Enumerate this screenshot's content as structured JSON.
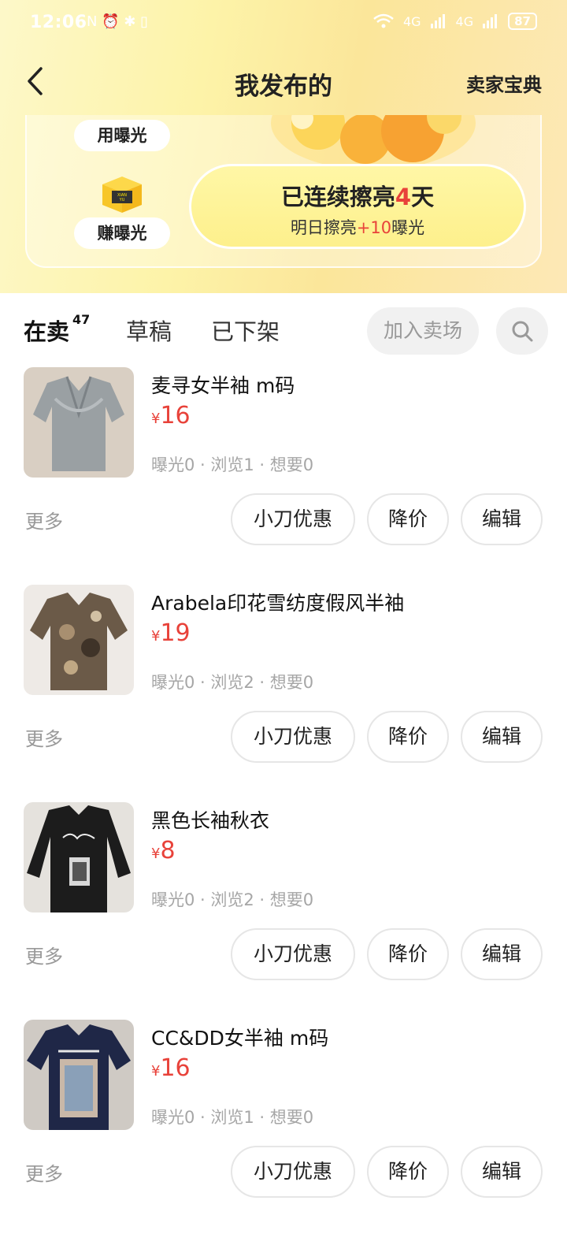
{
  "status_bar": {
    "time": "12:06",
    "left_icons": "N ⏰ ✱ ▯",
    "network": "4G",
    "battery": "87"
  },
  "nav": {
    "title": "我发布的",
    "right_link": "卖家宝典"
  },
  "promo": {
    "use_label": "用曝光",
    "earn_label": "赚曝光",
    "box_text": "XIAN YU",
    "streak_prefix": "已连续擦亮",
    "streak_days": "4",
    "streak_suffix": "天",
    "sub_prefix": "明日擦亮",
    "sub_bonus": "+10",
    "sub_suffix": "曝光"
  },
  "tabs": {
    "on_sale": "在卖",
    "on_sale_count": "47",
    "draft": "草稿",
    "off_shelf": "已下架",
    "join_button": "加入卖场"
  },
  "colors": {
    "accent_yellow": "#ffe600",
    "price_red": "#e8423a"
  },
  "listings": [
    {
      "title": "麦寻女半袖 m码",
      "currency": "¥",
      "price": "16",
      "stats": "曝光0 · 浏览1 · 想要0",
      "more": "更多",
      "btn_discount": "小刀优惠",
      "btn_reduce": "降价",
      "btn_edit": "编辑"
    },
    {
      "title": "Arabela印花雪纺度假风半袖",
      "currency": "¥",
      "price": "19",
      "stats": "曝光0 · 浏览2 · 想要0",
      "more": "更多",
      "btn_discount": "小刀优惠",
      "btn_reduce": "降价",
      "btn_edit": "编辑"
    },
    {
      "title": "黑色长袖秋衣",
      "currency": "¥",
      "price": "8",
      "stats": "曝光0 · 浏览2 · 想要0",
      "more": "更多",
      "btn_discount": "小刀优惠",
      "btn_reduce": "降价",
      "btn_edit": "编辑"
    },
    {
      "title": "CC&DD女半袖 m码",
      "currency": "¥",
      "price": "16",
      "stats": "曝光0 · 浏览1 · 想要0",
      "more": "更多",
      "btn_discount": "小刀优惠",
      "btn_reduce": "降价",
      "btn_edit": "编辑"
    }
  ]
}
